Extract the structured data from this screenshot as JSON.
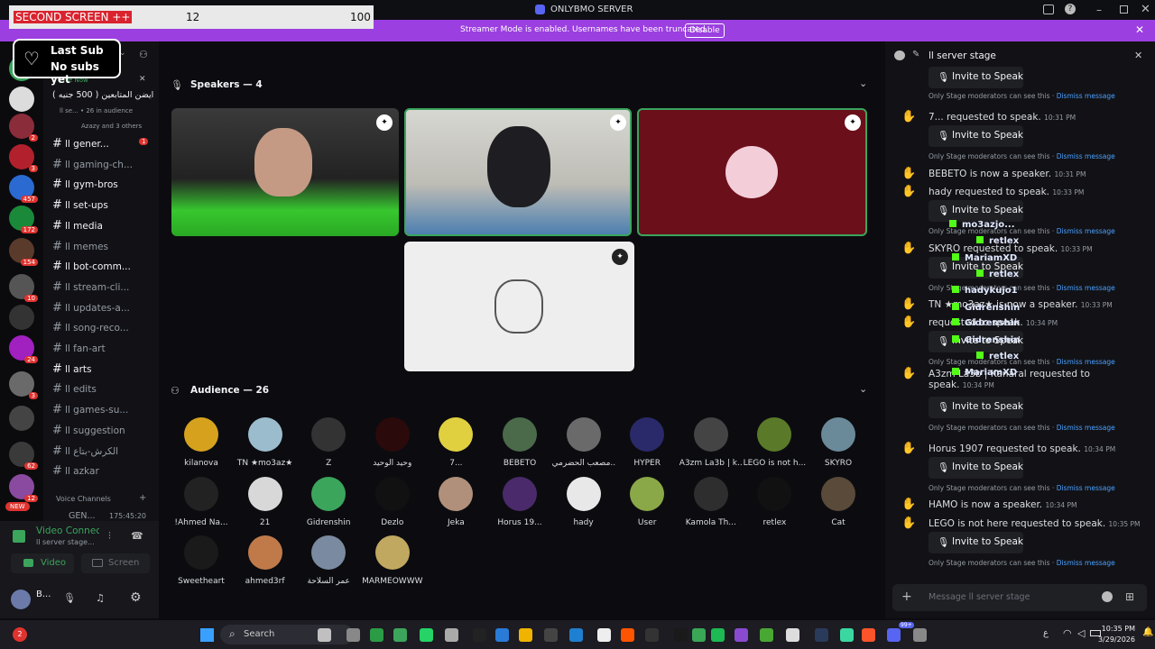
{
  "window": {
    "title": "ONLYBMO SERVER"
  },
  "banner": {
    "text": "Streamer Mode is enabled. Usernames have been truncated.",
    "button": "Disable"
  },
  "overlay": {
    "title": "SECOND SCREEN ++",
    "value1": "12",
    "value2": "100"
  },
  "last_sub": {
    "line1": "Last Sub",
    "line2": "No subs yet"
  },
  "event": {
    "live": "Live Now",
    "title": "ايضن المتابعين ( 500 جنيه )",
    "meta": "ll se... • 26 in audience",
    "attendees": "Azazy and 3 others"
  },
  "server_badges": [
    "2",
    "3",
    "457",
    "172",
    "154",
    "10",
    "24",
    "3",
    "62",
    "12",
    "NEW"
  ],
  "channels": [
    {
      "name": "ll gener...",
      "badge": "1"
    },
    {
      "name": "ll gaming-ch..."
    },
    {
      "name": "ll gym-bros"
    },
    {
      "name": "ll set-ups"
    },
    {
      "name": "ll media"
    },
    {
      "name": "ll memes"
    },
    {
      "name": "ll bot-comm..."
    },
    {
      "name": "ll stream-cli..."
    },
    {
      "name": "ll updates-a..."
    },
    {
      "name": "ll song-reco..."
    },
    {
      "name": "ll fan-art"
    },
    {
      "name": "ll arts"
    },
    {
      "name": "ll edits"
    },
    {
      "name": "ll games-su..."
    },
    {
      "name": "ll suggestion"
    },
    {
      "name": "ll الكرش-بتاع"
    },
    {
      "name": "ll azkar"
    }
  ],
  "voice_section": {
    "label": "Voice Channels",
    "channel": "GEN...",
    "timer": "175:45:20"
  },
  "voice_panel": {
    "status": "Video Connected",
    "channel": "ll server stage...",
    "video": "Video",
    "screen": "Screen"
  },
  "user": {
    "name": "B..."
  },
  "stage": {
    "speakers_label": "Speakers — 4",
    "audience_label": "Audience — 26",
    "audience": [
      "kilanova",
      "TN ★mo3az★",
      "Z",
      "وحيد الوحيد",
      "7...",
      "BEBETO",
      "مصعب الحضرمي...",
      "HYPER",
      "A3zm La3b | k...",
      "LEGO is not h...",
      "SKYRO",
      "!Ahmed Na...",
      "21",
      "Gidrenshin",
      "Dezlo",
      "Jeka",
      "Horus 19...",
      "hady",
      "User",
      "Kamola Th...",
      "retlex",
      "Cat",
      "Sweetheart",
      "ahmed3rf",
      "عمر السلاحة",
      "MARMEOWWW"
    ]
  },
  "chat": {
    "header": "ll server stage",
    "invite": "Invite to Speak",
    "note": "Only Stage moderators can see this ·",
    "dismiss": "Dismiss message",
    "entries": [
      {
        "text": "7... requested to speak.",
        "time": "10:31 PM"
      },
      {
        "text": "BEBETO is now a speaker.",
        "time": "10:31 PM"
      },
      {
        "text": "hady requested to speak.",
        "time": "10:33 PM"
      },
      {
        "text": "SKYRO requested to speak.",
        "time": "10:33 PM"
      },
      {
        "text": "TN ★mo3az★ is now a speaker.",
        "time": "10:33 PM"
      },
      {
        "text": "requested to speak.",
        "time": "10:34 PM"
      },
      {
        "text": "A3zm La3b | Kanaral requested to",
        "text2": "speak.",
        "time": "10:34 PM"
      },
      {
        "text": "Horus 1907 requested to speak.",
        "time": "10:34 PM"
      },
      {
        "text": "HAMO is now a speaker.",
        "time": "10:34 PM"
      },
      {
        "text": "LEGO is not here requested to speak.",
        "time": "10:35 PM"
      }
    ],
    "placeholder": "Message ll server stage"
  },
  "feed": [
    "mo3azjo...",
    "retlex",
    "MariamXD",
    "retlex",
    "hadykujo1",
    "Gidrenshin",
    "Gidrenshin",
    "Gidrenshin",
    "retlex",
    "MariamXD"
  ],
  "taskbar": {
    "search": "Search",
    "time": "10:35 PM",
    "date": "3/29/2026",
    "lang": "ع",
    "notif": "99+"
  }
}
